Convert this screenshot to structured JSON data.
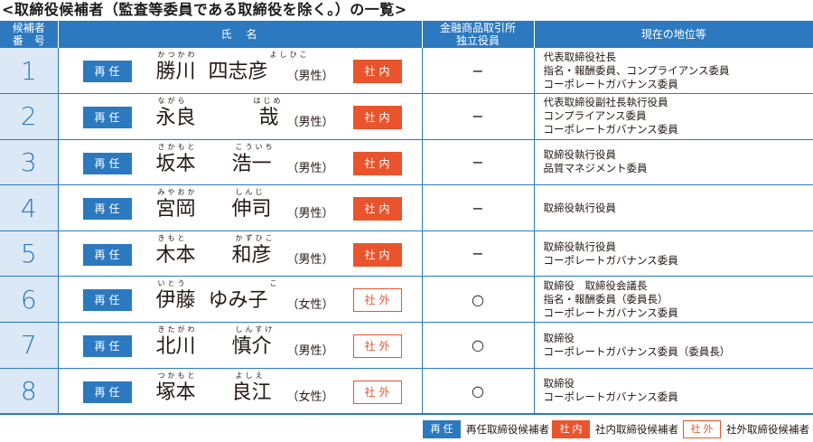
{
  "title": "<取締役候補者（監査等委員である取締役を除く。）の一覧>",
  "headers": {
    "num": "候補者\n番　号",
    "name": "氏　名",
    "indep": "金融商品取引所\n独立役員",
    "pos": "現在の地位等"
  },
  "candidates": [
    {
      "num": "1",
      "re": "再任",
      "ruby1": "かつかわ",
      "ruby2": "よしひこ",
      "fam": "勝川",
      "giv": "四志彦",
      "gender": "（男性）",
      "type": "社内",
      "type_kind": "in",
      "indep": "−",
      "pos": [
        "代表取締役社長",
        "指名・報酬委員、コンプライアンス委員",
        "コーポレートガバナンス委員"
      ]
    },
    {
      "num": "2",
      "re": "再任",
      "ruby1": "ながら",
      "ruby2": "はじめ",
      "fam": "永良",
      "giv": "哉",
      "gender": "（男性）",
      "type": "社内",
      "type_kind": "in",
      "indep": "−",
      "pos": [
        "代表取締役副社長執行役員",
        "コンプライアンス委員",
        "コーポレートガバナンス委員"
      ]
    },
    {
      "num": "3",
      "re": "再任",
      "ruby1": "さかもと",
      "ruby2": "こういち",
      "fam": "坂本",
      "giv": "浩一",
      "gender": "（男性）",
      "type": "社内",
      "type_kind": "in",
      "indep": "−",
      "pos": [
        "取締役執行役員",
        "品質マネジメント委員"
      ]
    },
    {
      "num": "4",
      "re": "再任",
      "ruby1": "みやおか",
      "ruby2": "しんじ",
      "fam": "宮岡",
      "giv": "伸司",
      "gender": "（男性）",
      "type": "社内",
      "type_kind": "in",
      "indep": "−",
      "pos": [
        "取締役執行役員"
      ]
    },
    {
      "num": "5",
      "re": "再任",
      "ruby1": "きもと",
      "ruby2": "かずひこ",
      "fam": "木本",
      "giv": "和彦",
      "gender": "（男性）",
      "type": "社内",
      "type_kind": "in",
      "indep": "−",
      "pos": [
        "取締役執行役員",
        "コーポレートガバナンス委員"
      ]
    },
    {
      "num": "6",
      "re": "再任",
      "ruby1": "いとう",
      "ruby2": "こ",
      "fam": "伊藤",
      "giv": "ゆみ子",
      "gender": "（女性）",
      "type": "社外",
      "type_kind": "out",
      "indep": "○",
      "pos": [
        "取締役　取締役会議長",
        "指名・報酬委員（委員長）",
        "コーポレートガバナンス委員"
      ]
    },
    {
      "num": "7",
      "re": "再任",
      "ruby1": "きたがわ",
      "ruby2": "しんすけ",
      "fam": "北川",
      "giv": "慎介",
      "gender": "（男性）",
      "type": "社外",
      "type_kind": "out",
      "indep": "○",
      "pos": [
        "取締役",
        "コーポレートガバナンス委員（委員長）"
      ]
    },
    {
      "num": "8",
      "re": "再任",
      "ruby1": "つかもと",
      "ruby2": "よしえ",
      "fam": "塚本",
      "giv": "良江",
      "gender": "（女性）",
      "type": "社外",
      "type_kind": "out",
      "indep": "○",
      "pos": [
        "取締役",
        "コーポレートガバナンス委員"
      ]
    }
  ],
  "legend": [
    {
      "badge": "再任",
      "label": "再任取締役候補者",
      "kind": "re"
    },
    {
      "badge": "社内",
      "label": "社内取締役候補者",
      "kind": "in"
    },
    {
      "badge": "社外",
      "label": "社外取締役候補者",
      "kind": "out"
    }
  ],
  "colors": {
    "blue": "#2c79c0",
    "orange": "#e9542d",
    "light_blue": "#dbe8f5"
  }
}
